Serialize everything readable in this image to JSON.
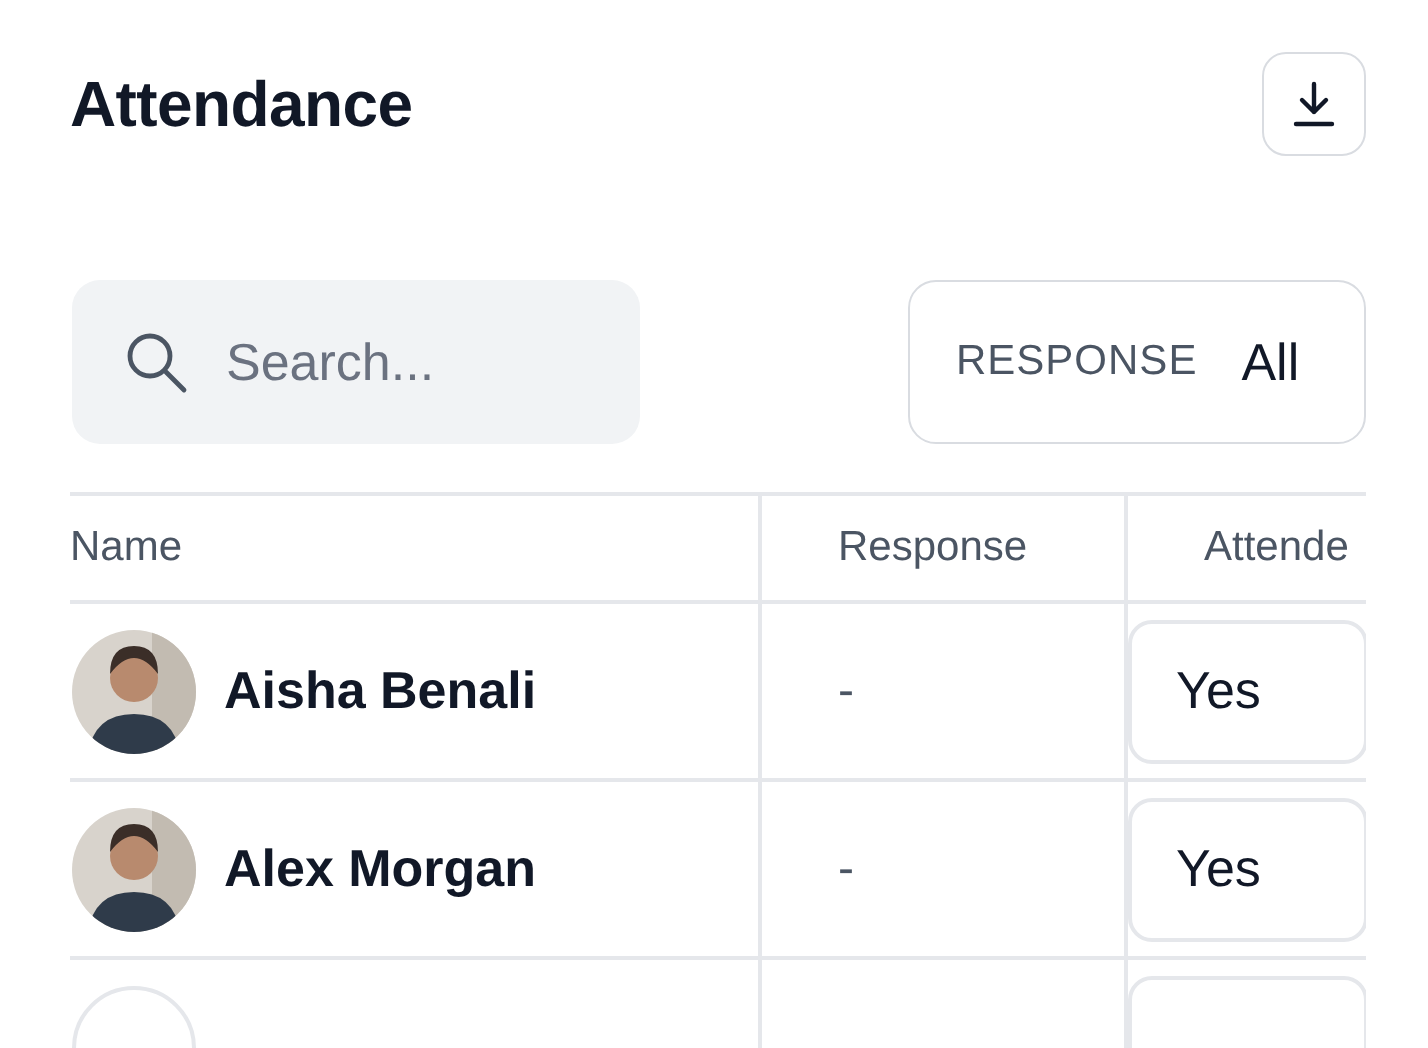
{
  "title": "Attendance",
  "search": {
    "placeholder": "Search..."
  },
  "filter": {
    "label": "RESPONSE",
    "value": "All"
  },
  "table": {
    "columns": [
      "Name",
      "Response",
      "Attende"
    ],
    "rows": [
      {
        "name": "Aisha Benali",
        "response": "-",
        "attended": "Yes"
      },
      {
        "name": "Alex Morgan",
        "response": "-",
        "attended": "Yes"
      },
      {
        "avatar": {
          "kind": "initials"
        }
      }
    ]
  }
}
